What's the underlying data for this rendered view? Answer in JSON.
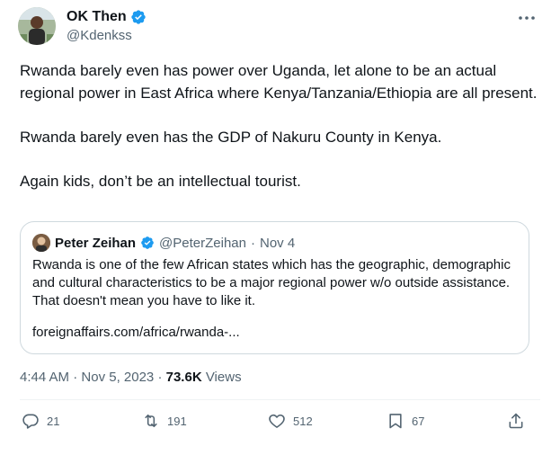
{
  "author": {
    "display_name": "OK Then",
    "handle": "@Kdenkss"
  },
  "tweet": {
    "paragraphs": [
      "Rwanda barely even has power over Uganda, let alone to be an actual regional power in East Africa where Kenya/Tanzania/Ethiopia are all present.",
      "Rwanda barely even has the GDP of Nakuru County in Kenya.",
      "Again kids, don’t be an  intellectual tourist."
    ]
  },
  "quote": {
    "display_name": "Peter Zeihan",
    "handle": "@PeterZeihan",
    "separator": "·",
    "date": "Nov 4",
    "text": "Rwanda is one of the few African states which has the geographic, demographic and cultural characteristics to be a major regional power w/o outside assistance. That doesn't mean you have to like it.",
    "link": "foreignaffairs.com/africa/rwanda-..."
  },
  "meta": {
    "time": "4:44 AM",
    "separator": "·",
    "date": "Nov 5, 2023",
    "views_count": "73.6K",
    "views_label": "Views"
  },
  "actions": {
    "reply_count": "21",
    "retweet_count": "191",
    "like_count": "512",
    "bookmark_count": "67"
  },
  "icons": {
    "verified": "verified-badge-icon",
    "more": "more-horizontal-icon",
    "reply": "reply-icon",
    "retweet": "retweet-icon",
    "like": "heart-icon",
    "bookmark": "bookmark-icon",
    "share": "share-icon"
  },
  "colors": {
    "text_primary": "#0f1419",
    "text_secondary": "#536471",
    "verified": "#1d9bf0",
    "border": "#cfd9de"
  }
}
